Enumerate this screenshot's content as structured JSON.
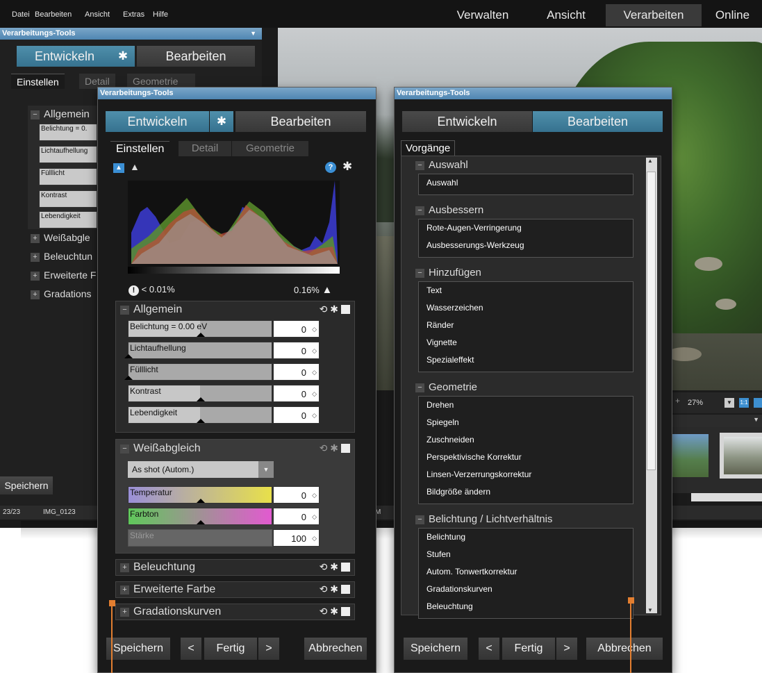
{
  "menu": [
    "Datei",
    "Bearbeiten",
    "Ansicht",
    "Extras",
    "Hilfe"
  ],
  "modes": [
    "Verwalten",
    "Ansicht",
    "Verarbeiten",
    "Online"
  ],
  "bg_panel": {
    "title": "Verarbeitungs-Tools",
    "develop": "Entwickeln",
    "edit": "Bearbeiten",
    "tabs": [
      "Einstellen",
      "Detail",
      "Geometrie"
    ],
    "section": "Allgemein",
    "sliders": [
      "Belichtung = 0.",
      "Lichtaufhellung",
      "Fülllicht",
      "Kontrast",
      "Lebendigkeit"
    ],
    "collapsed": [
      "Weißabgle",
      "Beleuchtun",
      "Erweiterte F",
      "Gradations"
    ],
    "save": "Speichern",
    "status_count": "23/23",
    "status_file": "IMG_0123",
    "status_m": "M"
  },
  "zoom": "27%",
  "one_to_one": "1:1",
  "left_panel": {
    "title": "Verarbeitungs-Tools",
    "develop": "Entwickeln",
    "edit": "Bearbeiten",
    "tabs": [
      "Einstellen",
      "Detail",
      "Geometrie"
    ],
    "clip_low": "< 0.01%",
    "clip_high": "0.16%",
    "general": {
      "title": "Allgemein",
      "sliders": [
        {
          "label": "Belichtung = 0.00 eV",
          "value": "0",
          "level": 0.5
        },
        {
          "label": "Lichtaufhellung",
          "value": "0",
          "level": 0.0
        },
        {
          "label": "Fülllicht",
          "value": "0",
          "level": 0.0
        },
        {
          "label": "Kontrast",
          "value": "0",
          "level": 0.5
        },
        {
          "label": "Lebendigkeit",
          "value": "0",
          "level": 0.5
        }
      ]
    },
    "wb": {
      "title": "Weißabgleich",
      "preset": "As shot (Autom.)",
      "sliders": [
        {
          "label": "Temperatur",
          "value": "0"
        },
        {
          "label": "Farbton",
          "value": "0"
        },
        {
          "label": "Stärke",
          "value": "100"
        }
      ]
    },
    "collapsed": [
      "Beleuchtung",
      "Erweiterte Farbe",
      "Gradationskurven"
    ],
    "save": "Speichern",
    "done": "Fertig",
    "cancel": "Abbrechen",
    "prev": "<",
    "next": ">"
  },
  "right_panel": {
    "title": "Verarbeitungs-Tools",
    "develop": "Entwickeln",
    "edit": "Bearbeiten",
    "tab": "Vorgänge",
    "groups": [
      {
        "title": "Auswahl",
        "items": [
          "Auswahl"
        ]
      },
      {
        "title": "Ausbessern",
        "items": [
          "Rote-Augen-Verringerung",
          "Ausbesserungs-Werkzeug"
        ]
      },
      {
        "title": "Hinzufügen",
        "items": [
          "Text",
          "Wasserzeichen",
          "Ränder",
          "Vignette",
          "Spezialeffekt"
        ]
      },
      {
        "title": "Geometrie",
        "items": [
          "Drehen",
          "Spiegeln",
          "Zuschneiden",
          "Perspektivische Korrektur",
          "Linsen-Verzerrungskorrektur",
          "Bildgröße ändern"
        ]
      },
      {
        "title": "Belichtung / Lichtverhältnis",
        "items": [
          "Belichtung",
          "Stufen",
          "Autom. Tonwertkorrektur",
          "Gradationskurven",
          "Beleuchtung"
        ]
      }
    ],
    "save": "Speichern",
    "done": "Fertig",
    "cancel": "Abbrechen",
    "prev": "<",
    "next": ">"
  },
  "colors": {
    "accent": "#3f809e",
    "title_bar": "#5f92bc",
    "callout": "#e27e30"
  }
}
